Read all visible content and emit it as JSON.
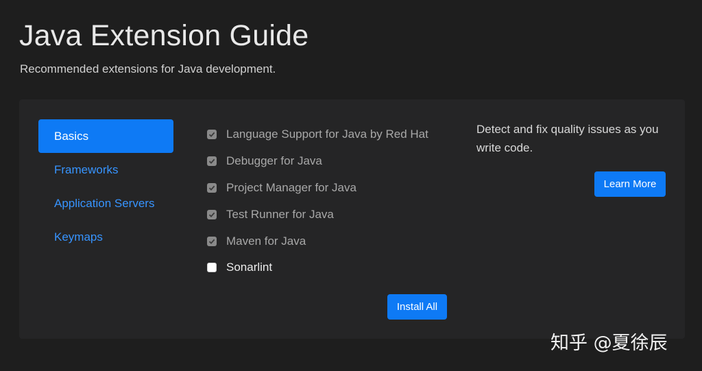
{
  "header": {
    "title": "Java Extension Guide",
    "subtitle": "Recommended extensions for Java development."
  },
  "nav": {
    "items": [
      {
        "label": "Basics",
        "active": true
      },
      {
        "label": "Frameworks",
        "active": false
      },
      {
        "label": "Application Servers",
        "active": false
      },
      {
        "label": "Keymaps",
        "active": false
      }
    ]
  },
  "extensions": [
    {
      "label": "Language Support for Java by Red Hat",
      "checked": true,
      "disabled": true
    },
    {
      "label": "Debugger for Java",
      "checked": true,
      "disabled": true
    },
    {
      "label": "Project Manager for Java",
      "checked": true,
      "disabled": true
    },
    {
      "label": "Test Runner for Java",
      "checked": true,
      "disabled": true
    },
    {
      "label": "Maven for Java",
      "checked": true,
      "disabled": true
    },
    {
      "label": "Sonarlint",
      "checked": false,
      "disabled": false
    }
  ],
  "actions": {
    "install_all_label": "Install All",
    "learn_more_label": "Learn More"
  },
  "detail": {
    "description": "Detect and fix quality issues as you write code."
  },
  "watermark": "知乎 @夏徐辰",
  "colors": {
    "background": "#1e1e1e",
    "panel": "#252526",
    "accent": "#0e7af5",
    "link": "#3794ff"
  }
}
